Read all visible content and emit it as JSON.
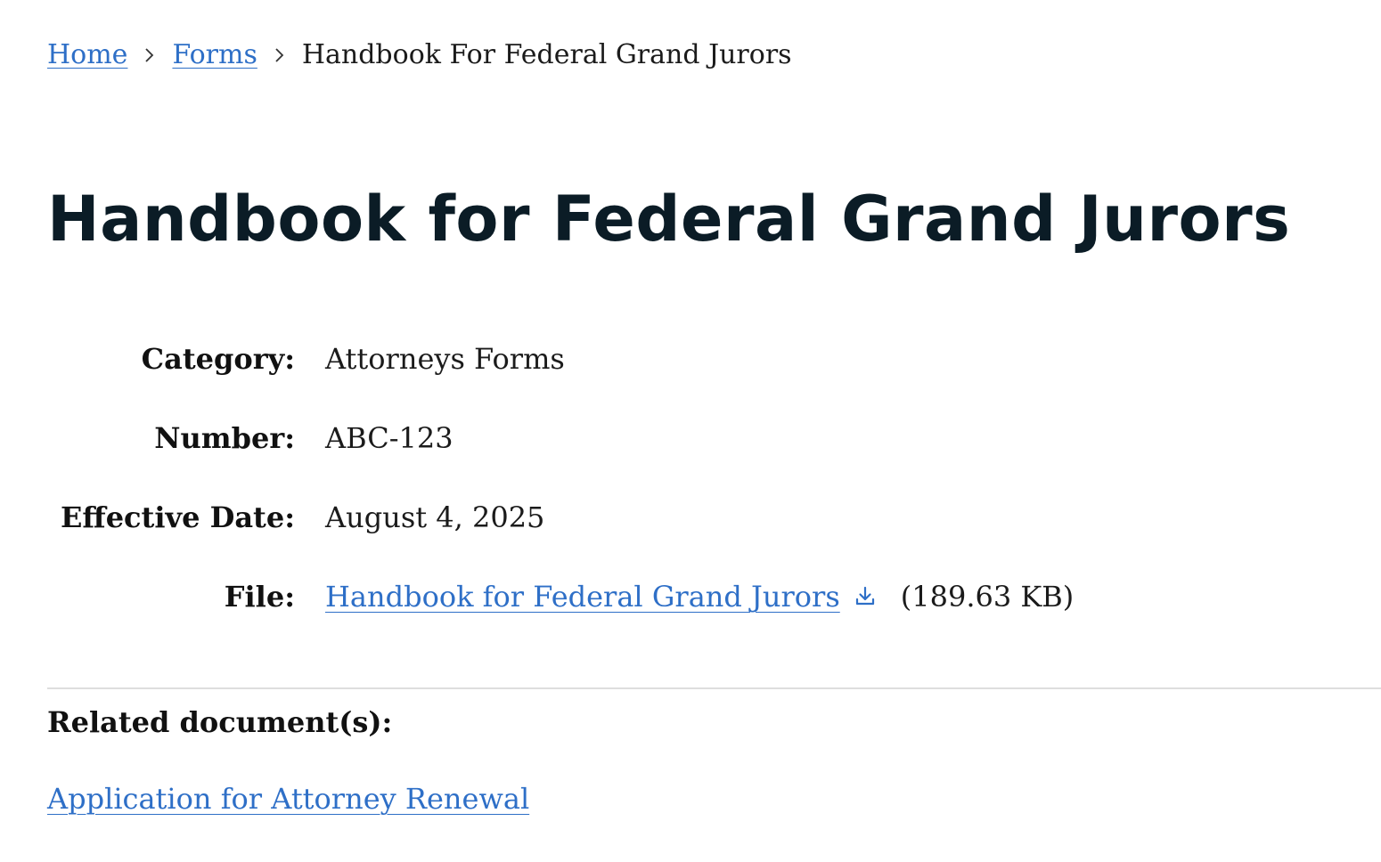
{
  "breadcrumb": {
    "home": "Home",
    "forms": "Forms",
    "current": "Handbook For Federal Grand Jurors",
    "separator_icon": "chevron-right-icon"
  },
  "page_title": "Handbook for Federal Grand Jurors",
  "meta": {
    "category_label": "Category:",
    "category_value": "Attorneys Forms",
    "number_label": "Number:",
    "number_value": "ABC-123",
    "effective_date_label": "Effective Date:",
    "effective_date_value": "August 4, 2025",
    "file_label": "File:",
    "file_link": "Handbook for Federal Grand Jurors",
    "file_icon": "download-icon",
    "file_size": "(189.63 KB)"
  },
  "related": {
    "heading": "Related document(s):",
    "links": [
      "Application for Attorney Renewal"
    ]
  },
  "colors": {
    "link": "#2e6fc7",
    "title": "#0b1c26",
    "text": "#1b1b1b",
    "divider": "#dedede"
  }
}
